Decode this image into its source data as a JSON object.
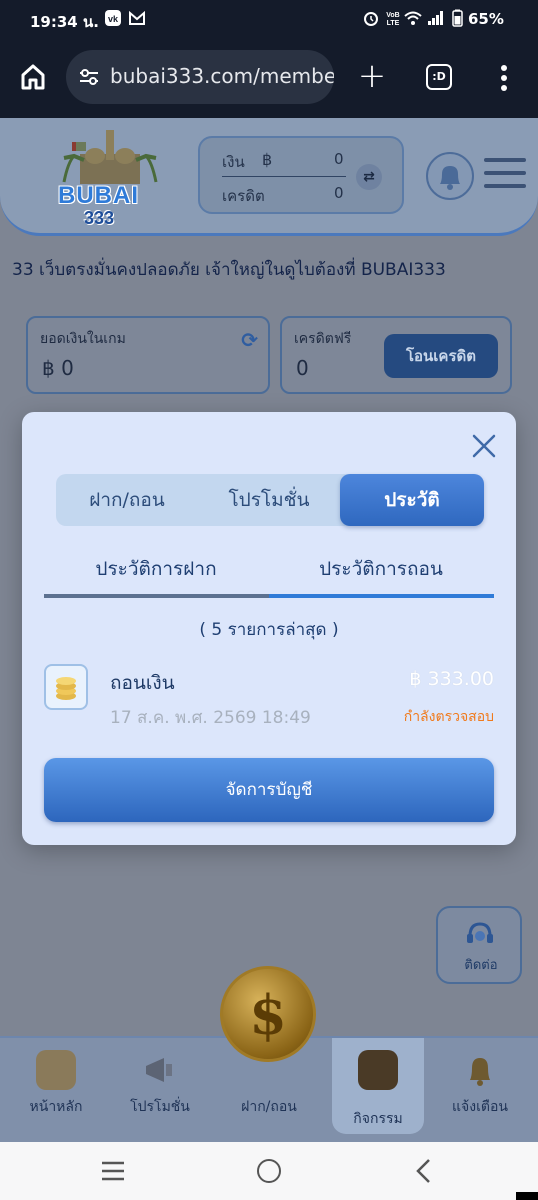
{
  "status_bar": {
    "time": "19:34 น.",
    "battery": "65%"
  },
  "browser": {
    "url": "bubai333.com/membe",
    "tabs_count": ":D"
  },
  "header": {
    "logo_word": "BUBAI",
    "logo_number": "333",
    "money_label": "เงิน",
    "currency": "฿",
    "money_value": "0",
    "credit_label": "เครดิต",
    "credit_value": "0"
  },
  "marquee_text": "33 เว็บตรงมั่นคงปลอดภัย เจ้าใหญ่ในดูไบต้องที่ BUBAI333",
  "wallet": {
    "game_balance_label": "ยอดเงินในเกม",
    "game_balance_value": "฿ 0",
    "free_credit_label": "เครดิตฟรี",
    "free_credit_value": "0",
    "transfer_label": "โอนเครดิต"
  },
  "contact_label": "ติดต่อ",
  "bottom_nav": {
    "items": [
      {
        "label": "หน้าหลัก"
      },
      {
        "label": "โปรโมชั่น"
      },
      {
        "label": "ฝาก/ถอน"
      },
      {
        "label": "กิจกรรม"
      },
      {
        "label": "แจ้งเตือน"
      }
    ]
  },
  "modal": {
    "tabs": [
      {
        "label": "ฝาก/ถอน"
      },
      {
        "label": "โปรโมชั่น"
      },
      {
        "label": "ประวัติ"
      }
    ],
    "active_tab": "ประวัติ",
    "subtabs": [
      {
        "label": "ประวัติการฝาก"
      },
      {
        "label": "ประวัติการถอน"
      }
    ],
    "active_subtab": "ประวัติการถอน",
    "recent_label": "( 5 รายการล่าสุด )",
    "transactions": [
      {
        "title": "ถอนเงิน",
        "date": "17 ส.ค. พ.ศ. 2569 18:49",
        "amount": "฿  333.00",
        "status": "กำลังตรวจสอบ"
      }
    ],
    "manage_button": "จัดการบัญชี"
  },
  "colors": {
    "accent_blue": "#2f7bd8",
    "status_orange": "#f07a1c",
    "modal_bg": "#dce6fb"
  }
}
